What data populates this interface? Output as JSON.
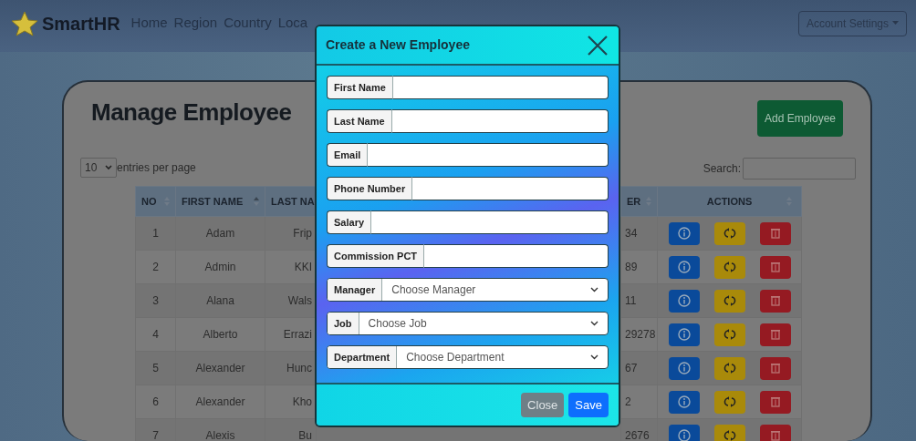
{
  "navbar": {
    "brand": "SmartHR",
    "links": [
      "Home",
      "Region",
      "Country",
      "Loca"
    ],
    "account": "Account Settings"
  },
  "page": {
    "title": "Manage Employee",
    "add_button": "Add Employee",
    "page_size": "10",
    "page_size_label": "entries per page",
    "search_label": "Search:"
  },
  "table": {
    "columns": [
      {
        "label": "NO",
        "kind": "sortable"
      },
      {
        "label": "FIRST NAME",
        "kind": "sorted"
      },
      {
        "label": "LAST NA",
        "kind": "plain"
      },
      {
        "label": "ER",
        "kind": "sortable"
      },
      {
        "label": "ACTIONS",
        "kind": "sortable"
      }
    ],
    "actions": [
      {
        "kind": "info"
      },
      {
        "kind": "update"
      },
      {
        "kind": "delete"
      }
    ],
    "rows": [
      {
        "no": "1",
        "first_name": "Adam",
        "last_name": "Frip",
        "phone": "34"
      },
      {
        "no": "2",
        "first_name": "Admin",
        "last_name": "KKI",
        "phone": "89"
      },
      {
        "no": "3",
        "first_name": "Alana",
        "last_name": "Wals",
        "phone": "11"
      },
      {
        "no": "4",
        "first_name": "Alberto",
        "last_name": "Errazi",
        "phone": "29278"
      },
      {
        "no": "5",
        "first_name": "Alexander",
        "last_name": "Hunc",
        "phone": "67"
      },
      {
        "no": "6",
        "first_name": "Alexander",
        "last_name": "Kho",
        "phone": "2"
      },
      {
        "no": "7",
        "first_name": "Alexis",
        "last_name": "Bu",
        "phone": "2676"
      }
    ]
  },
  "modal": {
    "title": "Create a New Employee",
    "fields": [
      {
        "kind": "text",
        "label": "First Name"
      },
      {
        "kind": "text",
        "label": "Last Name"
      },
      {
        "kind": "text",
        "label": "Email"
      },
      {
        "kind": "text",
        "label": "Phone Number"
      },
      {
        "kind": "text",
        "label": "Salary"
      },
      {
        "kind": "text",
        "label": "Commission PCT"
      },
      {
        "kind": "select",
        "label": "Manager",
        "placeholder": "Choose Manager"
      },
      {
        "kind": "select",
        "label": "Job",
        "placeholder": "Choose Job"
      },
      {
        "kind": "select",
        "label": "Department",
        "placeholder": "Choose Department"
      }
    ],
    "buttons": [
      {
        "kind": "secondary",
        "label": "Close"
      },
      {
        "kind": "primary",
        "label": "Save"
      }
    ]
  }
}
